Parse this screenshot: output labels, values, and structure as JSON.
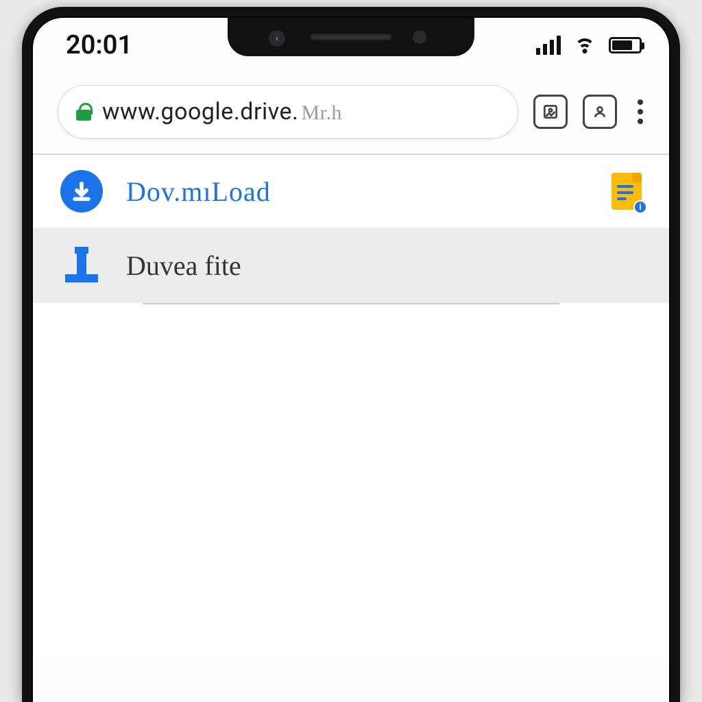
{
  "status": {
    "time": "20:01"
  },
  "toolbar": {
    "url_main": "www.google.drive.",
    "url_suffix": "Mr.h"
  },
  "rows": [
    {
      "label": "Dov.mıLoad",
      "doc_badge": "i"
    },
    {
      "label": "Duvea fite"
    }
  ]
}
